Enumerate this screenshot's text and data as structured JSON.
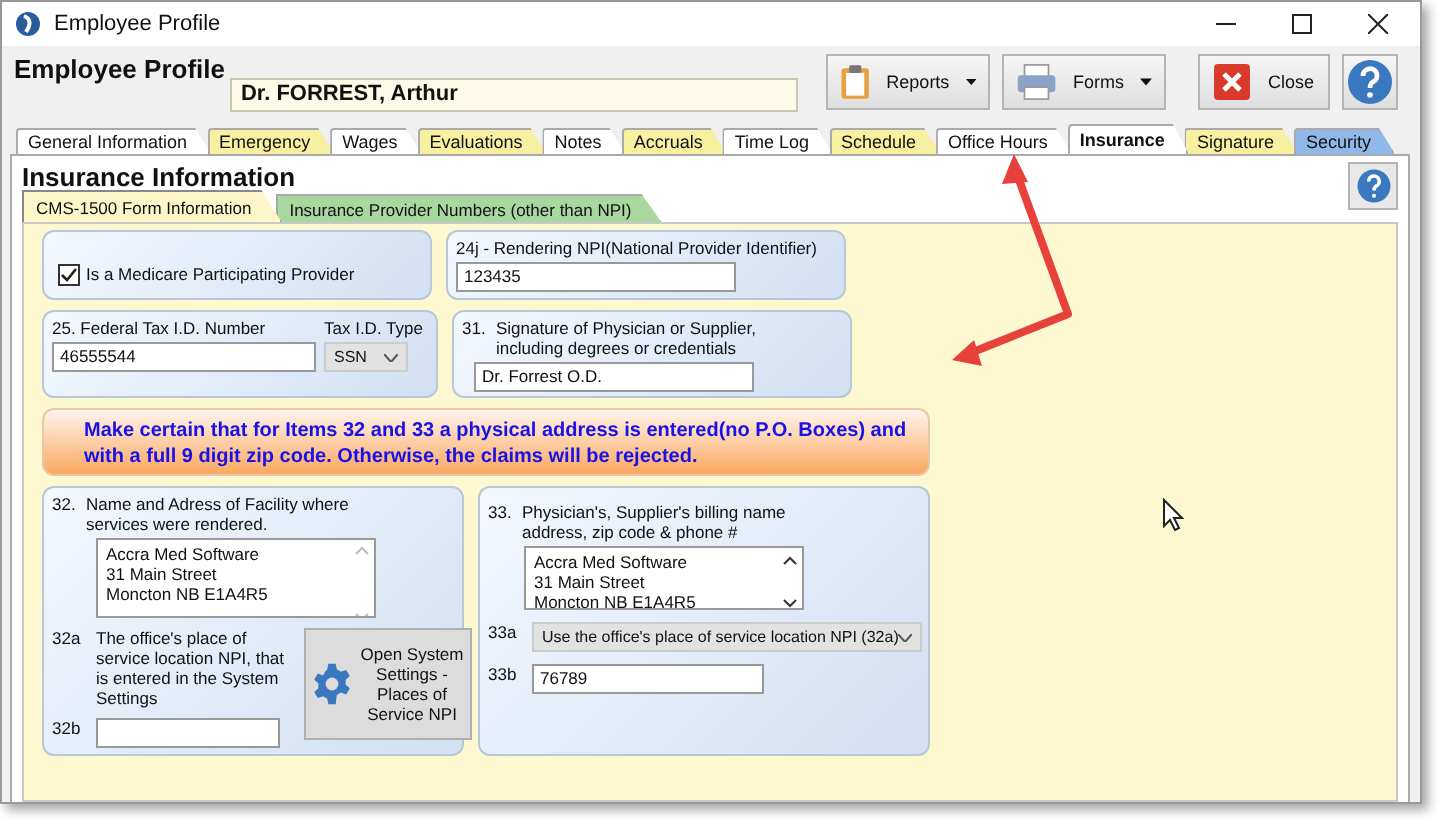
{
  "window": {
    "title": "Employee Profile"
  },
  "header": {
    "title": "Employee Profile",
    "employee_name": "Dr. FORREST, Arthur",
    "buttons": [
      {
        "kind": "reports",
        "label": "Reports"
      },
      {
        "kind": "forms",
        "label": "Forms"
      },
      {
        "kind": "close",
        "label": "Close"
      },
      {
        "kind": "help"
      }
    ]
  },
  "tabs": [
    {
      "label": "General Information",
      "color": "#ffffff",
      "selected": false
    },
    {
      "label": "Emergency",
      "color": "#f7f0a0",
      "selected": false
    },
    {
      "label": "Wages",
      "color": "#ffffff",
      "selected": false
    },
    {
      "label": "Evaluations",
      "color": "#f7f0a0",
      "selected": false
    },
    {
      "label": "Notes",
      "color": "#ffffff",
      "selected": false
    },
    {
      "label": "Accruals",
      "color": "#f7f0a0",
      "selected": false
    },
    {
      "label": "Time Log",
      "color": "#ffffff",
      "selected": false
    },
    {
      "label": "Schedule",
      "color": "#f7f0a0",
      "selected": false
    },
    {
      "label": "Office Hours",
      "color": "#ffffff",
      "selected": false
    },
    {
      "label": "Insurance",
      "color": "#ffffff",
      "selected": true
    },
    {
      "label": "Signature",
      "color": "#f7f0a0",
      "selected": false
    },
    {
      "label": "Security",
      "color": "#8fb8e8",
      "selected": false
    }
  ],
  "section_title": "Insurance Information",
  "subtabs": [
    {
      "label": "CMS-1500 Form Information",
      "color": "#fdf6c8",
      "selected": true
    },
    {
      "label": "Insurance Provider Numbers (other than NPI)",
      "color": "#a8d8a0",
      "selected": false
    }
  ],
  "medicare": {
    "label": "Is a Medicare Participating Provider",
    "checked": true
  },
  "npi": {
    "label": "24j - Rendering NPI(National Provider Identifier)",
    "value": "123435"
  },
  "tax_id": {
    "label": "25. Federal Tax I.D. Number",
    "value": "46555544"
  },
  "tax_type": {
    "label": "Tax I.D. Type",
    "value": "SSN"
  },
  "signature": {
    "number": "31.",
    "label": "Signature of Physician or Supplier, including degrees or credentials",
    "value": "Dr. Forrest O.D."
  },
  "warning": "Make certain that for Items 32 and 33 a physical address is entered(no P.O. Boxes) and with a full 9 digit zip code.  Otherwise, the claims will be rejected.",
  "facility": {
    "number": "32.",
    "label": "Name and Adress of Facility where services were rendered.",
    "address": [
      "Accra Med Software",
      "31 Main Street",
      "Moncton NB E1A4R5"
    ],
    "item_32a": {
      "code": "32a",
      "text": "The office's place of service location NPI, that is entered in the System Settings"
    },
    "item_32b": {
      "code": "32b"
    },
    "settings_button": "Open System Settings - Places of Service NPI"
  },
  "billing": {
    "number": "33.",
    "label": "Physician's, Supplier's billing name address, zip code & phone #",
    "address": [
      "Accra Med Software",
      "31 Main Street",
      "Moncton NB E1A4R5"
    ],
    "item_33a": {
      "code": "33a",
      "value": "Use the office's place of service location NPI (32a)"
    },
    "item_33b": {
      "code": "33b",
      "value": "76789"
    }
  }
}
